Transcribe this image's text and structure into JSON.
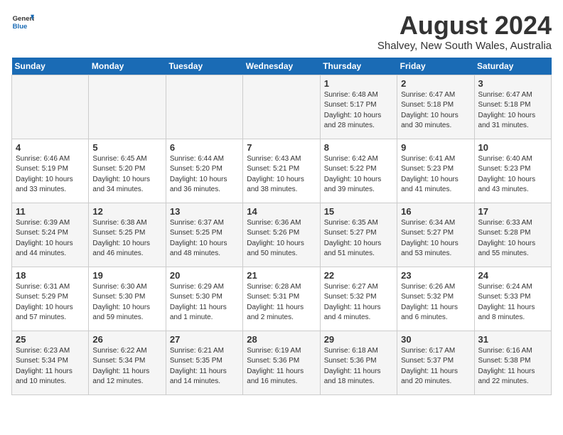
{
  "logo": {
    "line1": "General",
    "line2": "Blue"
  },
  "title": "August 2024",
  "location": "Shalvey, New South Wales, Australia",
  "days_header": [
    "Sunday",
    "Monday",
    "Tuesday",
    "Wednesday",
    "Thursday",
    "Friday",
    "Saturday"
  ],
  "weeks": [
    [
      {
        "day": "",
        "info": ""
      },
      {
        "day": "",
        "info": ""
      },
      {
        "day": "",
        "info": ""
      },
      {
        "day": "",
        "info": ""
      },
      {
        "day": "1",
        "info": "Sunrise: 6:48 AM\nSunset: 5:17 PM\nDaylight: 10 hours\nand 28 minutes."
      },
      {
        "day": "2",
        "info": "Sunrise: 6:47 AM\nSunset: 5:18 PM\nDaylight: 10 hours\nand 30 minutes."
      },
      {
        "day": "3",
        "info": "Sunrise: 6:47 AM\nSunset: 5:18 PM\nDaylight: 10 hours\nand 31 minutes."
      }
    ],
    [
      {
        "day": "4",
        "info": "Sunrise: 6:46 AM\nSunset: 5:19 PM\nDaylight: 10 hours\nand 33 minutes."
      },
      {
        "day": "5",
        "info": "Sunrise: 6:45 AM\nSunset: 5:20 PM\nDaylight: 10 hours\nand 34 minutes."
      },
      {
        "day": "6",
        "info": "Sunrise: 6:44 AM\nSunset: 5:20 PM\nDaylight: 10 hours\nand 36 minutes."
      },
      {
        "day": "7",
        "info": "Sunrise: 6:43 AM\nSunset: 5:21 PM\nDaylight: 10 hours\nand 38 minutes."
      },
      {
        "day": "8",
        "info": "Sunrise: 6:42 AM\nSunset: 5:22 PM\nDaylight: 10 hours\nand 39 minutes."
      },
      {
        "day": "9",
        "info": "Sunrise: 6:41 AM\nSunset: 5:23 PM\nDaylight: 10 hours\nand 41 minutes."
      },
      {
        "day": "10",
        "info": "Sunrise: 6:40 AM\nSunset: 5:23 PM\nDaylight: 10 hours\nand 43 minutes."
      }
    ],
    [
      {
        "day": "11",
        "info": "Sunrise: 6:39 AM\nSunset: 5:24 PM\nDaylight: 10 hours\nand 44 minutes."
      },
      {
        "day": "12",
        "info": "Sunrise: 6:38 AM\nSunset: 5:25 PM\nDaylight: 10 hours\nand 46 minutes."
      },
      {
        "day": "13",
        "info": "Sunrise: 6:37 AM\nSunset: 5:25 PM\nDaylight: 10 hours\nand 48 minutes."
      },
      {
        "day": "14",
        "info": "Sunrise: 6:36 AM\nSunset: 5:26 PM\nDaylight: 10 hours\nand 50 minutes."
      },
      {
        "day": "15",
        "info": "Sunrise: 6:35 AM\nSunset: 5:27 PM\nDaylight: 10 hours\nand 51 minutes."
      },
      {
        "day": "16",
        "info": "Sunrise: 6:34 AM\nSunset: 5:27 PM\nDaylight: 10 hours\nand 53 minutes."
      },
      {
        "day": "17",
        "info": "Sunrise: 6:33 AM\nSunset: 5:28 PM\nDaylight: 10 hours\nand 55 minutes."
      }
    ],
    [
      {
        "day": "18",
        "info": "Sunrise: 6:31 AM\nSunset: 5:29 PM\nDaylight: 10 hours\nand 57 minutes."
      },
      {
        "day": "19",
        "info": "Sunrise: 6:30 AM\nSunset: 5:30 PM\nDaylight: 10 hours\nand 59 minutes."
      },
      {
        "day": "20",
        "info": "Sunrise: 6:29 AM\nSunset: 5:30 PM\nDaylight: 11 hours\nand 1 minute."
      },
      {
        "day": "21",
        "info": "Sunrise: 6:28 AM\nSunset: 5:31 PM\nDaylight: 11 hours\nand 2 minutes."
      },
      {
        "day": "22",
        "info": "Sunrise: 6:27 AM\nSunset: 5:32 PM\nDaylight: 11 hours\nand 4 minutes."
      },
      {
        "day": "23",
        "info": "Sunrise: 6:26 AM\nSunset: 5:32 PM\nDaylight: 11 hours\nand 6 minutes."
      },
      {
        "day": "24",
        "info": "Sunrise: 6:24 AM\nSunset: 5:33 PM\nDaylight: 11 hours\nand 8 minutes."
      }
    ],
    [
      {
        "day": "25",
        "info": "Sunrise: 6:23 AM\nSunset: 5:34 PM\nDaylight: 11 hours\nand 10 minutes."
      },
      {
        "day": "26",
        "info": "Sunrise: 6:22 AM\nSunset: 5:34 PM\nDaylight: 11 hours\nand 12 minutes."
      },
      {
        "day": "27",
        "info": "Sunrise: 6:21 AM\nSunset: 5:35 PM\nDaylight: 11 hours\nand 14 minutes."
      },
      {
        "day": "28",
        "info": "Sunrise: 6:19 AM\nSunset: 5:36 PM\nDaylight: 11 hours\nand 16 minutes."
      },
      {
        "day": "29",
        "info": "Sunrise: 6:18 AM\nSunset: 5:36 PM\nDaylight: 11 hours\nand 18 minutes."
      },
      {
        "day": "30",
        "info": "Sunrise: 6:17 AM\nSunset: 5:37 PM\nDaylight: 11 hours\nand 20 minutes."
      },
      {
        "day": "31",
        "info": "Sunrise: 6:16 AM\nSunset: 5:38 PM\nDaylight: 11 hours\nand 22 minutes."
      }
    ]
  ]
}
